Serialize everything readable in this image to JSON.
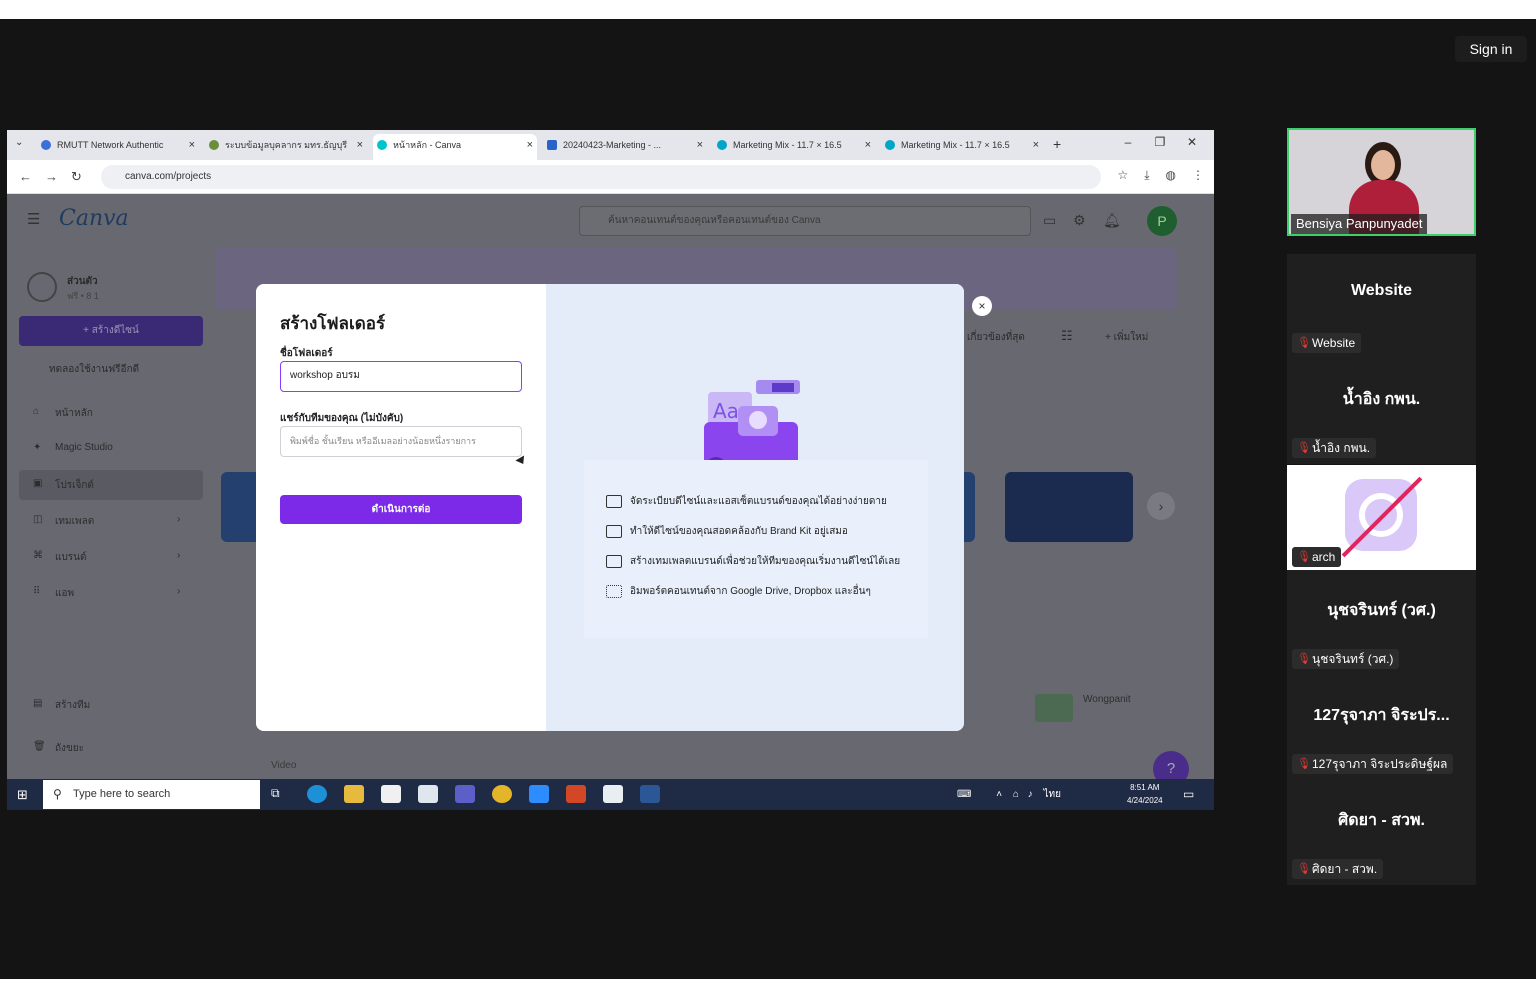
{
  "meeting": {
    "sign_in_label": "Sign in"
  },
  "browser": {
    "tabs": [
      {
        "label": "RMUTT Network Authentic"
      },
      {
        "label": "ระบบข้อมูลบุคลากร มทร.ธัญบุรี"
      },
      {
        "label": "หน้าหลัก - Canva"
      },
      {
        "label": "20240423-Marketing - ..."
      },
      {
        "label": "Marketing Mix - 11.7 × 16.5"
      },
      {
        "label": "Marketing Mix - 11.7 × 16.5"
      }
    ],
    "new_tab_label": "+",
    "url": "canva.com/projects"
  },
  "canva": {
    "logo": "Canva",
    "search_placeholder": "ค้นหาคอนเทนต์ของคุณหรือคอนเทนต์ของ Canva",
    "avatar_letter": "P",
    "account_name": "ส่วนตัว",
    "account_sub": "ฟรี • 8 1",
    "create_design_label": "+ สร้างดีไซน์",
    "trial_label": "ทดลองใช้งานฟรีอีกดี",
    "nav": [
      {
        "label": "หน้าหลัก"
      },
      {
        "label": "Magic Studio"
      },
      {
        "label": "โปรเจ็กต์"
      },
      {
        "label": "เทมเพลต"
      },
      {
        "label": "แบรนด์"
      },
      {
        "label": "แอพ"
      }
    ],
    "nav_bottom": [
      {
        "label": "สร้างทีม"
      },
      {
        "label": "ถังขยะ"
      }
    ],
    "add_new_label": "+ เพิ่มใหม่",
    "sort_label": "เกี่ยวข้องที่สุด",
    "video_label": "Video",
    "owner_label": "Wongpanit",
    "help_label": "?"
  },
  "modal": {
    "title": "สร้างโฟลเดอร์",
    "name_label": "ชื่อโฟลเดอร์",
    "name_value": "workshop อบรม",
    "share_label": "แชร์กับทีมของคุณ (ไม่บังคับ)",
    "share_placeholder": "พิมพ์ชื่อ ชั้นเรียน หรืออีเมลอย่างน้อยหนึ่งรายการ",
    "continue_label": "ดำเนินการต่อ",
    "close_label": "×",
    "features": [
      {
        "text": "จัดระเบียบดีไซน์และแอสเซ็ตแบรนด์ของคุณได้อย่างง่ายดาย"
      },
      {
        "text": "ทำให้ดีไซน์ของคุณสอดคล้องกับ Brand Kit อยู่เสมอ"
      },
      {
        "text": "สร้างเทมเพลตแบรนด์เพื่อช่วยให้ทีมของคุณเริ่มงานดีไซน์ได้เลย"
      },
      {
        "text": "อิมพอร์ตคอนเทนต์จาก Google Drive, Dropbox และอื่นๆ"
      }
    ]
  },
  "taskbar": {
    "search_placeholder": "Type here to search",
    "lang": "ไทย",
    "time": "8:51 AM",
    "date": "4/24/2024"
  },
  "participants": {
    "video_name": "Bensiya Panpunyadet",
    "tiles": [
      {
        "big": "Website",
        "small": "Website"
      },
      {
        "big": "น้ำอิง กพน.",
        "small": "น้ำอิง กพน."
      },
      {
        "big": "",
        "small": "arch"
      },
      {
        "big": "นุชจรินทร์ (วศ.)",
        "small": "นุชจรินทร์ (วศ.)"
      },
      {
        "big": "127รุจาภา จิระปร...",
        "small": "127รุจาภา จิระประดิษฐ์ผล"
      },
      {
        "big": "ศิดยา - สวพ.",
        "small": "ศิดยา - สวพ."
      }
    ]
  },
  "colors": {
    "canva_purple": "#7d2ae8",
    "meeting_bg": "#141414",
    "active_speaker": "#3ccf6b"
  }
}
